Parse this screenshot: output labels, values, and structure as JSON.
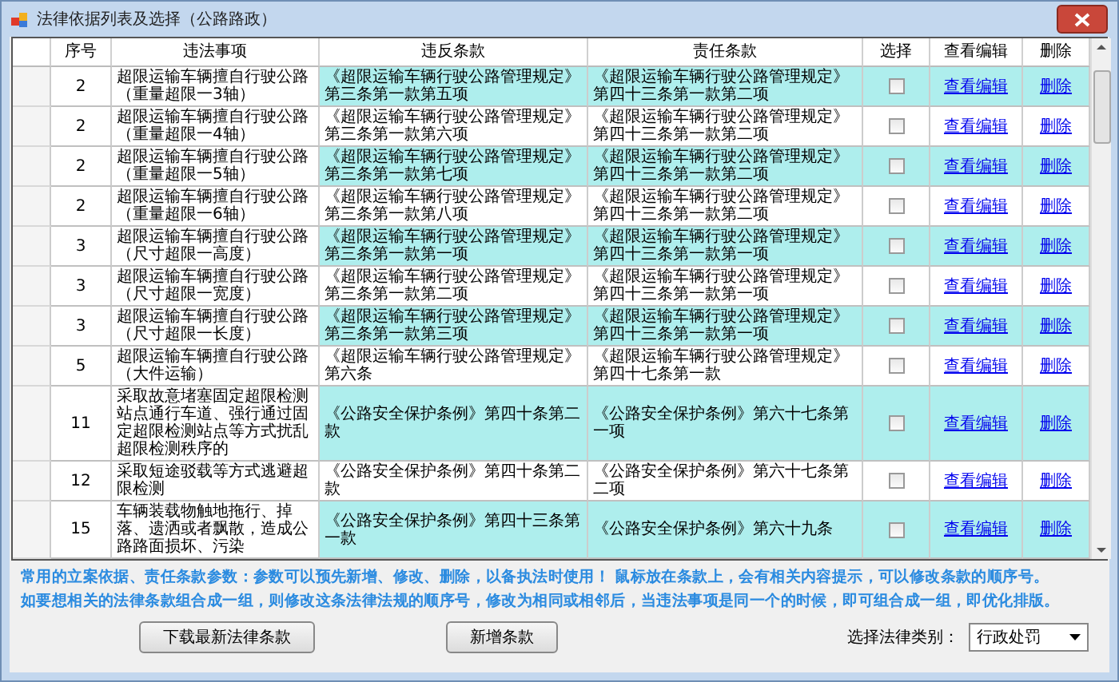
{
  "window": {
    "title": "法律依据列表及选择（公路路政）"
  },
  "table": {
    "columns": [
      "序号",
      "违法事项",
      "违反条款",
      "责任条款",
      "选择",
      "查看编辑",
      "删除"
    ],
    "rows": [
      {
        "seq": "2",
        "violation": "超限运输车辆擅自行驶公路（重量超限一3轴）",
        "violated_clause": "《超限运输车辆行驶公路管理规定》第三条第一款第五项",
        "liability_clause": "《超限运输车辆行驶公路管理规定》第四十三条第一款第二项",
        "checked": false,
        "view_link": "查看编辑",
        "delete_link": "删除"
      },
      {
        "seq": "2",
        "violation": "超限运输车辆擅自行驶公路（重量超限一4轴）",
        "violated_clause": "《超限运输车辆行驶公路管理规定》第三条第一款第六项",
        "liability_clause": "《超限运输车辆行驶公路管理规定》第四十三条第一款第二项",
        "checked": false,
        "view_link": "查看编辑",
        "delete_link": "删除"
      },
      {
        "seq": "2",
        "violation": "超限运输车辆擅自行驶公路（重量超限一5轴）",
        "violated_clause": "《超限运输车辆行驶公路管理规定》第三条第一款第七项",
        "liability_clause": "《超限运输车辆行驶公路管理规定》第四十三条第一款第二项",
        "checked": false,
        "view_link": "查看编辑",
        "delete_link": "删除"
      },
      {
        "seq": "2",
        "violation": "超限运输车辆擅自行驶公路（重量超限一6轴）",
        "violated_clause": "《超限运输车辆行驶公路管理规定》第三条第一款第八项",
        "liability_clause": "《超限运输车辆行驶公路管理规定》第四十三条第一款第二项",
        "checked": false,
        "view_link": "查看编辑",
        "delete_link": "删除"
      },
      {
        "seq": "3",
        "violation": "超限运输车辆擅自行驶公路（尺寸超限一高度）",
        "violated_clause": "《超限运输车辆行驶公路管理规定》第三条第一款第一项",
        "liability_clause": "《超限运输车辆行驶公路管理规定》第四十三条第一款第一项",
        "checked": false,
        "view_link": "查看编辑",
        "delete_link": "删除"
      },
      {
        "seq": "3",
        "violation": "超限运输车辆擅自行驶公路（尺寸超限一宽度）",
        "violated_clause": "《超限运输车辆行驶公路管理规定》第三条第一款第二项",
        "liability_clause": "《超限运输车辆行驶公路管理规定》第四十三条第一款第一项",
        "checked": false,
        "view_link": "查看编辑",
        "delete_link": "删除"
      },
      {
        "seq": "3",
        "violation": "超限运输车辆擅自行驶公路（尺寸超限一长度）",
        "violated_clause": "《超限运输车辆行驶公路管理规定》第三条第一款第三项",
        "liability_clause": "《超限运输车辆行驶公路管理规定》第四十三条第一款第一项",
        "checked": false,
        "view_link": "查看编辑",
        "delete_link": "删除"
      },
      {
        "seq": "5",
        "violation": "超限运输车辆擅自行驶公路（大件运输）",
        "violated_clause": "《超限运输车辆行驶公路管理规定》第六条",
        "liability_clause": "《超限运输车辆行驶公路管理规定》第四十七条第一款",
        "checked": false,
        "view_link": "查看编辑",
        "delete_link": "删除"
      },
      {
        "seq": "11",
        "violation": "采取故意堵塞固定超限检测站点通行车道、强行通过固定超限检测站点等方式扰乱超限检测秩序的",
        "violated_clause": "《公路安全保护条例》第四十条第二款",
        "liability_clause": "《公路安全保护条例》第六十七条第一项",
        "checked": false,
        "view_link": "查看编辑",
        "delete_link": "删除"
      },
      {
        "seq": "12",
        "violation": "采取短途驳载等方式逃避超限检测",
        "violated_clause": "《公路安全保护条例》第四十条第二款",
        "liability_clause": "《公路安全保护条例》第六十七条第二项",
        "checked": false,
        "view_link": "查看编辑",
        "delete_link": "删除"
      },
      {
        "seq": "15",
        "violation": "车辆装载物触地拖行、掉落、遗洒或者飘散，造成公路路面损坏、污染",
        "violated_clause": "《公路安全保护条例》第四十三条第一款",
        "liability_clause": "《公路安全保护条例》第六十九条",
        "checked": false,
        "view_link": "查看编辑",
        "delete_link": "删除"
      }
    ]
  },
  "notes": [
    "常用的立案依据、责任条款参数：参数可以预先新增、修改、删除，以备执法时使用！ 鼠标放在条款上，会有相关内容提示，可以修改条款的顺序号。",
    "如要想相关的法律条款组合成一组，则修改这条法律法规的顺序号，修改为相同或相邻后，当违法事项是同一个的时候，即可组合成一组，即优化排版。"
  ],
  "buttons": [
    "下载最新法律条款",
    "新增条款"
  ],
  "law_type": {
    "label": "选择法律类别：",
    "value": "行政处罚"
  }
}
